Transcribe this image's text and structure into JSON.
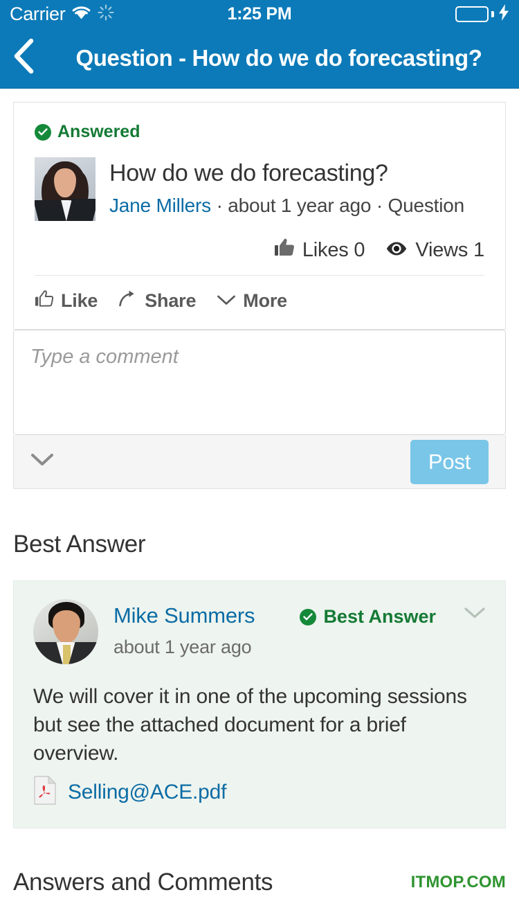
{
  "status_bar": {
    "carrier": "Carrier",
    "time": "1:25 PM",
    "wifi_icon": "wifi-icon",
    "activity_icon": "activity-spinner-icon",
    "battery_icon": "battery-full-icon",
    "charging_icon": "lightning-bolt-icon"
  },
  "nav": {
    "back_icon": "chevron-left-icon",
    "title": "Question - How do we do forecasting?"
  },
  "question": {
    "status_badge": "Answered",
    "status_icon": "check-circle-icon",
    "avatar": "avatar-jane-millers",
    "title": "How do we do forecasting?",
    "author": "Jane Millers",
    "separator_1": "·",
    "time": "about 1 year ago",
    "separator_2": "·",
    "type": "Question",
    "stats": {
      "likes_icon": "thumbs-up-filled-icon",
      "likes_label": "Likes 0",
      "views_icon": "eye-icon",
      "views_label": "Views 1"
    },
    "actions": [
      {
        "icon": "thumbs-up-outline-icon",
        "label": "Like"
      },
      {
        "icon": "share-arrow-icon",
        "label": "Share"
      },
      {
        "icon": "chevron-down-icon",
        "label": "More"
      }
    ]
  },
  "composer": {
    "placeholder": "Type a comment",
    "value": "",
    "expand_icon": "chevron-down-icon",
    "post_label": "Post"
  },
  "best_answer": {
    "heading": "Best Answer",
    "avatar": "avatar-mike-summers",
    "author": "Mike Summers",
    "time": "about 1 year ago",
    "badge": "Best Answer",
    "badge_icon": "check-circle-icon",
    "collapse_icon": "chevron-down-icon",
    "body": "We will cover it in one of the upcoming sessions but see the attached document for a brief overview.",
    "attachment": {
      "icon": "pdf-file-icon",
      "name": "Selling@ACE.pdf"
    }
  },
  "answers_section": {
    "heading": "Answers and Comments"
  },
  "watermark": {
    "text": "ITMOP.COM"
  },
  "colors": {
    "nav_blue": "#0c7ab8",
    "link_blue": "#0b6ca5",
    "success_green": "#147a35",
    "post_blue": "#79c6e8",
    "answer_bg": "#eef4ef",
    "watermark_green": "#2f9430",
    "battery_green": "#4cd661"
  }
}
